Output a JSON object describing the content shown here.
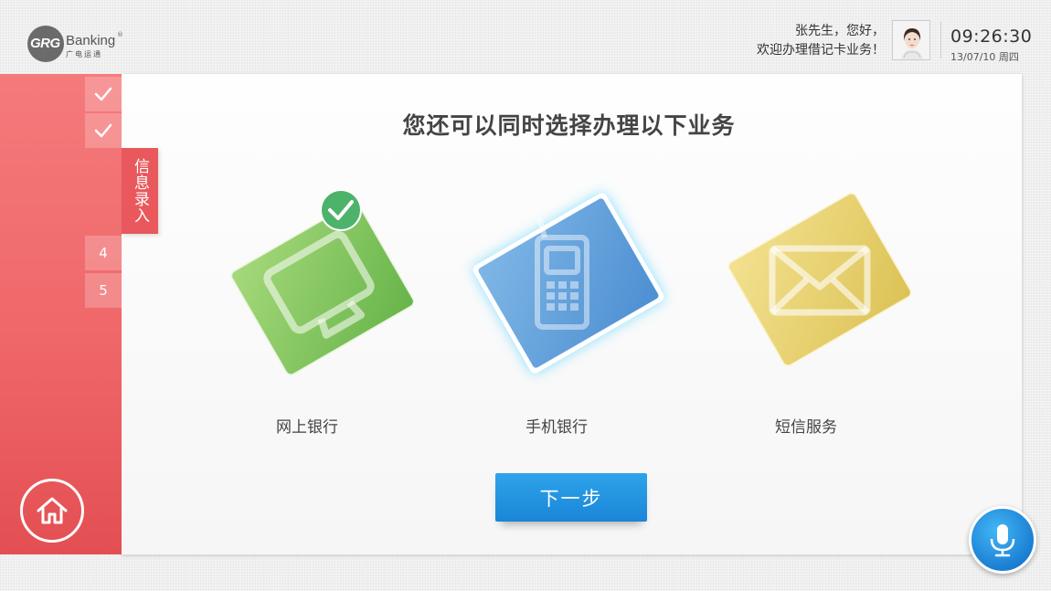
{
  "header": {
    "logo": {
      "grg": "GRG",
      "banking": "Banking",
      "cn": "广电运通",
      "reg": "®"
    },
    "greeting_line1": "张先生，您好，",
    "greeting_line2": "欢迎办理借记卡业务！",
    "time": "09:26:30",
    "date": "13/07/10 周四"
  },
  "sidebar": {
    "steps": [
      {
        "label": "",
        "status": "done",
        "icon": "check-icon"
      },
      {
        "label": "",
        "status": "done",
        "icon": "check-icon"
      },
      {
        "label": "信息录入",
        "status": "current"
      },
      {
        "label": "4",
        "status": "pending"
      },
      {
        "label": "5",
        "status": "pending"
      }
    ],
    "home_icon": "home-icon"
  },
  "main": {
    "title": "您还可以同时选择办理以下业务",
    "services": [
      {
        "label": "网上银行",
        "icon": "monitor-icon",
        "color": "#7cc35a",
        "selected": true
      },
      {
        "label": "手机银行",
        "icon": "mobile-phone-icon",
        "color": "#5a9ad6",
        "highlighted": true
      },
      {
        "label": "短信服务",
        "icon": "envelope-icon",
        "color": "#ead36c",
        "selected": false
      }
    ],
    "next_label": "下一步"
  },
  "mic_icon": "microphone-icon",
  "colors": {
    "sidebar_red": "#ef6769",
    "accent_blue": "#1a86d8",
    "check_green": "#4db36b"
  }
}
